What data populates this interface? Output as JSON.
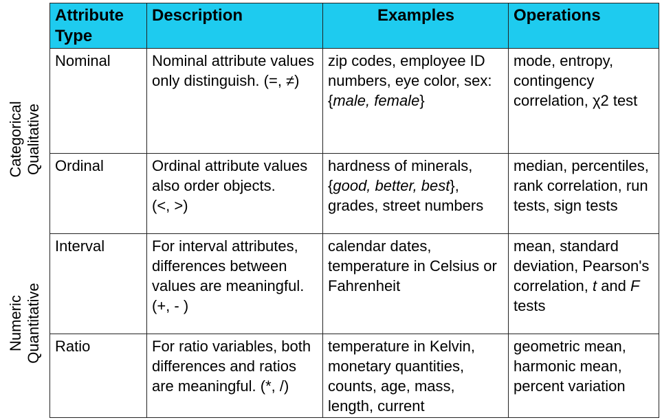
{
  "side_labels": {
    "categorical": {
      "line1": "Categorical",
      "line2": "Qualitative"
    },
    "numeric": {
      "line1": "Numeric",
      "line2": "Quantitative"
    }
  },
  "header": {
    "attribute_type": "Attribute Type",
    "description": "Description",
    "examples": "Examples",
    "operations": "Operations"
  },
  "rows": {
    "nominal": {
      "type": "Nominal",
      "description": "Nominal attribute values only distinguish. (=, ≠)",
      "examples_pre": "zip codes, employee ID numbers, eye color, sex: {",
      "examples_italic": "male, female",
      "examples_post": "}",
      "operations": "mode, entropy, contingency correlation, χ2 test"
    },
    "ordinal": {
      "type": "Ordinal",
      "description": "Ordinal attribute values also order objects.\n(<, >)",
      "examples_pre": "hardness of minerals, {",
      "examples_italic": "good, better, best",
      "examples_post": "}, grades, street numbers",
      "operations": "median, percentiles, rank correlation, run tests, sign tests"
    },
    "interval": {
      "type": "Interval",
      "description": "For interval attributes, differences between values are meaningful. (+, - )",
      "examples": "calendar dates, temperature in Celsius or Fahrenheit",
      "operations_pre": "mean, standard deviation, Pearson's correlation, ",
      "operations_t": "t",
      "operations_mid": " and ",
      "operations_f": "F",
      "operations_post": " tests"
    },
    "ratio": {
      "type": "Ratio",
      "description": "For ratio variables, both differences and ratios are meaningful. (*, /)",
      "examples": "temperature in Kelvin, monetary quantities, counts, age, mass, length, current",
      "operations": "geometric mean, harmonic mean, percent variation"
    }
  }
}
